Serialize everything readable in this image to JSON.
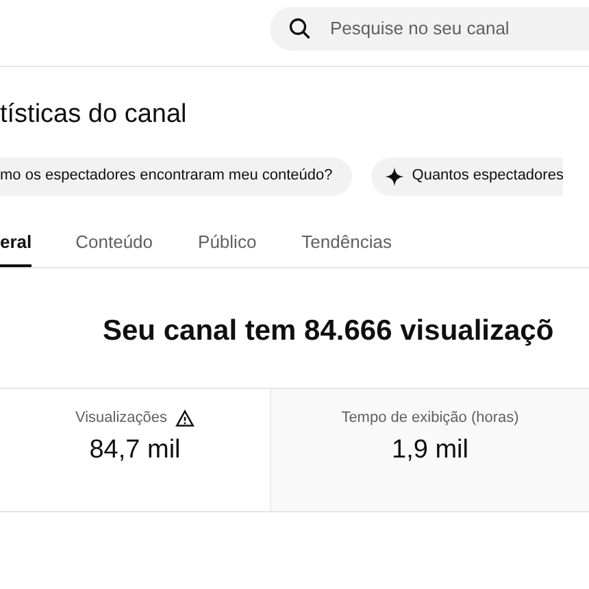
{
  "search": {
    "placeholder": "Pesquise no seu canal"
  },
  "title": "tísticas do canal",
  "suggestions": [
    {
      "text": "mo os espectadores encontraram meu conteúdo?",
      "sparkle": false
    },
    {
      "text": "Quantos espectadores",
      "sparkle": true
    }
  ],
  "tabs": [
    {
      "label": "eral",
      "selected": true
    },
    {
      "label": "Conteúdo",
      "selected": false
    },
    {
      "label": "Público",
      "selected": false
    },
    {
      "label": "Tendências",
      "selected": false
    }
  ],
  "headline": "Seu canal tem 84.666 visualizaçõ",
  "metrics": [
    {
      "label": "Visualizações",
      "value": "84,7 mil",
      "warning": true,
      "selected": false
    },
    {
      "label": "Tempo de exibição (horas)",
      "value": "1,9 mil",
      "warning": false,
      "selected": true
    }
  ]
}
